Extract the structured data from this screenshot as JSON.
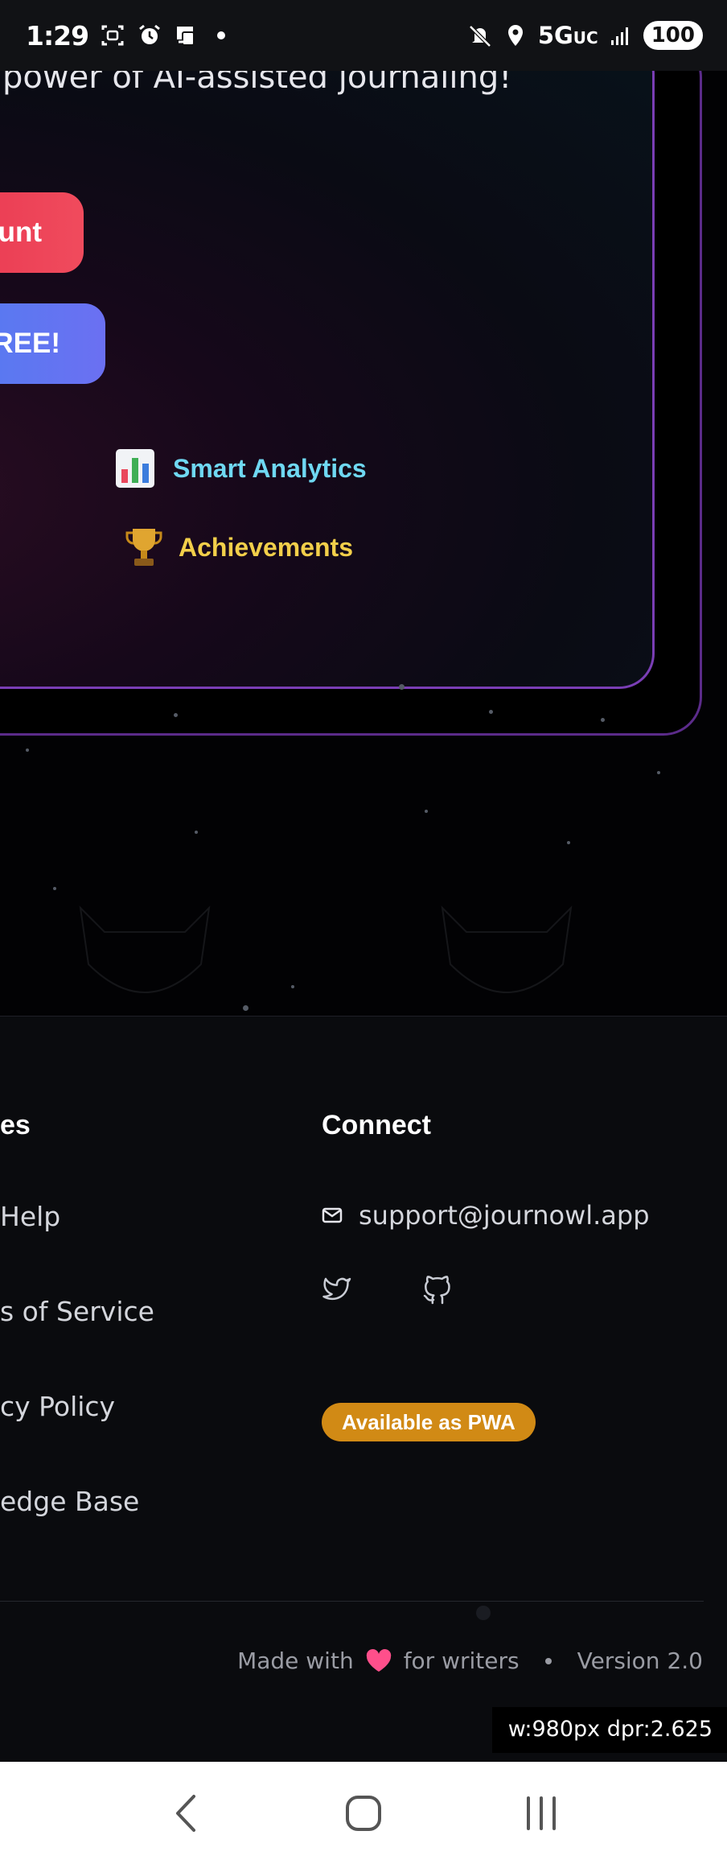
{
  "status_bar": {
    "time": "1:29",
    "network": "5G",
    "network_suffix": "UC",
    "battery": "100",
    "icons": [
      "screenshot-icon",
      "alarm-icon",
      "device-icon",
      "mute-icon",
      "location-icon",
      "signal-icon"
    ]
  },
  "hero": {
    "subtitle": "power of AI-assisted journaling!",
    "primary_button": "ount",
    "secondary_button": "FREE!",
    "features": [
      {
        "icon": "bar-chart-icon",
        "label": "Smart Analytics",
        "color": "#6fd8f2"
      },
      {
        "icon": "trophy-icon",
        "label": "Achievements",
        "color": "#f2cf4a"
      }
    ]
  },
  "footer": {
    "resources_heading": "es",
    "resources_links": [
      "Help",
      "s of Service",
      "cy Policy",
      "edge Base"
    ],
    "connect_heading": "Connect",
    "email": "support@journowl.app",
    "social": [
      "twitter-icon",
      "github-icon"
    ],
    "pwa_badge": "Available as PWA",
    "made_with_prefix": "Made with",
    "made_with_suffix": "for writers",
    "version": "Version 2.0"
  },
  "debug_overlay": "w:980px dpr:2.625",
  "colors": {
    "primary_button": "#e8364f",
    "secondary_button": "#5b74ee",
    "card_border": "#7a3eb5",
    "badge": "#d18a15",
    "heart": "#ff4f8b"
  }
}
